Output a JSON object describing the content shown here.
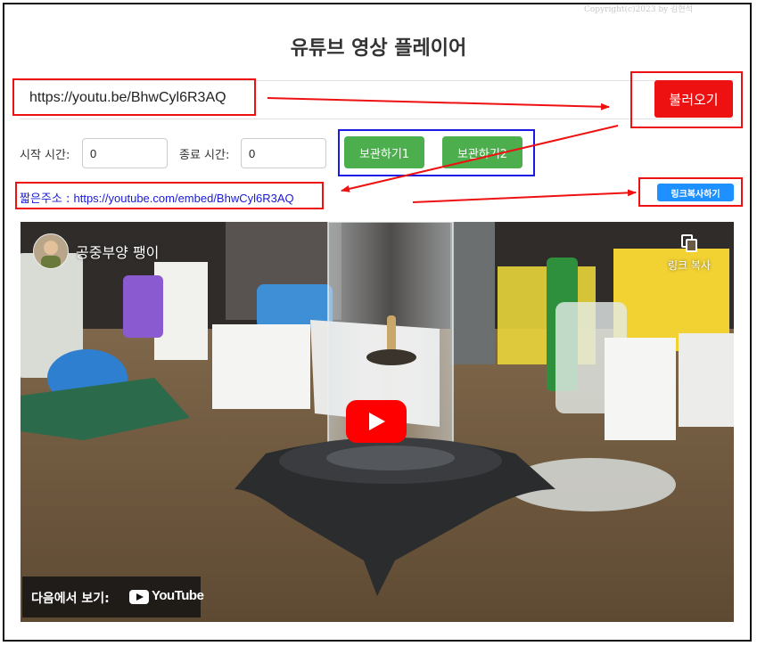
{
  "copyright": "Copyright(c)2023 by 김현석",
  "title": "유튜브 영상 플레이어",
  "url_input": {
    "value": "https://youtu.be/BhwCyl6R3AQ"
  },
  "load_button": "불러오기",
  "start_time": {
    "label": "시작 시간:",
    "value": "0"
  },
  "end_time": {
    "label": "종료 시간:",
    "value": "0"
  },
  "save_buttons": [
    "보관하기1",
    "보관하기2"
  ],
  "short_url": {
    "label": "짧은주소 : ",
    "value": "https://youtube.com/embed/BhwCyl6R3AQ"
  },
  "copy_link_button": "링크복사하기",
  "video": {
    "channel_name": "공중부양 팽이",
    "copy_link": "링크 복사",
    "watch_on": "다음에서 보기:",
    "youtube_logo": "YouTube"
  },
  "colors": {
    "annotation_red": "#ee1111",
    "annotation_blue": "#1a1ae6",
    "load_button": "#ee1111",
    "save_button": "#4cae4c",
    "copy_button": "#1e90ff",
    "link_text": "#1a1ad6"
  }
}
